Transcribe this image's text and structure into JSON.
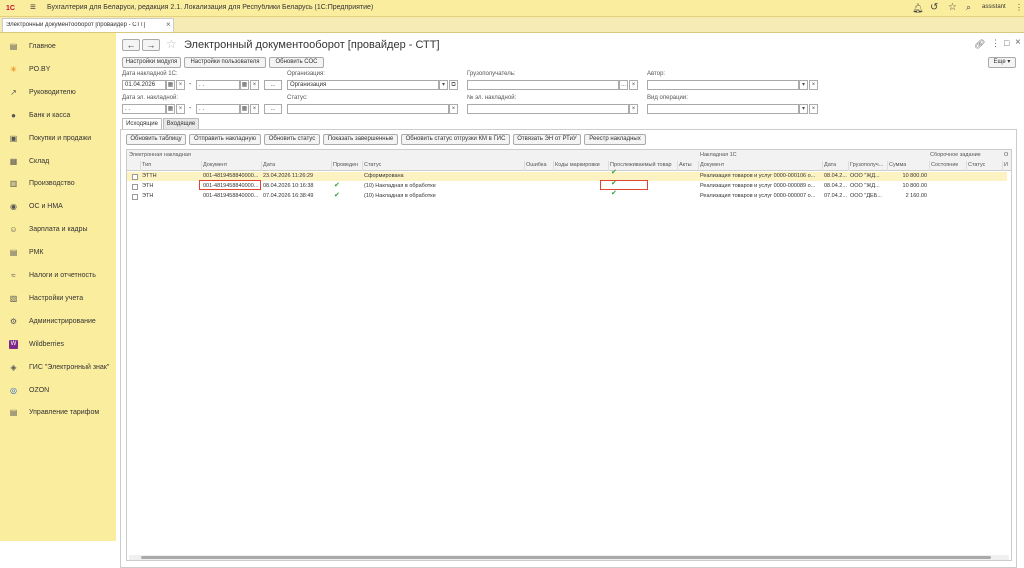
{
  "app": {
    "title": "Бухгалтерия для Беларуси, редакция 2.1. Локализация для Республики Беларусь   (1С:Предприятие)",
    "user": "assistant"
  },
  "tab": {
    "label": "Электронный документооборот [провайдер - СТТ]"
  },
  "sidebar": {
    "items": [
      {
        "label": "Главное",
        "icon": "menu-icon"
      },
      {
        "label": "PO.BY",
        "icon": "star-icon"
      },
      {
        "label": "Руководителю",
        "icon": "chart-icon"
      },
      {
        "label": "Банк и касса",
        "icon": "coin-icon"
      },
      {
        "label": "Покупки и продажи",
        "icon": "cart-icon"
      },
      {
        "label": "Склад",
        "icon": "warehouse-icon"
      },
      {
        "label": "Производство",
        "icon": "factory-icon"
      },
      {
        "label": "ОС и НМА",
        "icon": "car-icon"
      },
      {
        "label": "Зарплата и кадры",
        "icon": "people-icon"
      },
      {
        "label": "РМК",
        "icon": "register-icon"
      },
      {
        "label": "Налоги и отчетность",
        "icon": "tax-icon"
      },
      {
        "label": "Настройки учета",
        "icon": "settings-doc-icon"
      },
      {
        "label": "Администрирование",
        "icon": "gear-icon"
      },
      {
        "label": "Wildberries",
        "icon": "wildberries-icon"
      },
      {
        "label": "ГИС \"Электронный знак\"",
        "icon": "gis-icon"
      },
      {
        "label": "OZON",
        "icon": "ozon-icon"
      },
      {
        "label": "Управление тарифом",
        "icon": "tariff-icon"
      }
    ]
  },
  "page": {
    "title": "Электронный документооборот [провайдер - СТТ]",
    "more_label": "Еще"
  },
  "toolbar": {
    "module_settings": "Настройки модуля",
    "user_settings": "Настройки пользователя",
    "update_sos": "Обновить СОС"
  },
  "filters": {
    "invoice_date_1c_label": "Дата накладной 1С:",
    "invoice_date_1c_from": "01.04.2026",
    "invoice_date_1c_to": "  .  .",
    "org_label": "Организация:",
    "org_value": "Организация",
    "consignee_label": "Грузополучатель:",
    "consignee_value": "",
    "author_label": "Автор:",
    "author_value": "",
    "en_date_label": "Дата эл. накладной:",
    "en_date_from": "  .  .",
    "en_date_to": "  .  .",
    "status_label": "Статус:",
    "status_value": "",
    "en_number_label": "№ эл. накладной:",
    "en_number_value": "",
    "op_type_label": "Вид операции:",
    "op_type_value": ""
  },
  "subtabs": [
    "Исходящие",
    "Входящие"
  ],
  "actions": [
    "Обновить таблицу",
    "Отправить накладную",
    "Обновить статус",
    "Показать завершенные",
    "Обновить статус отгрузки КМ в ГИС",
    "Отвязать ЭН от РТиУ",
    "Реестр накладных"
  ],
  "table": {
    "groups": {
      "en": "Электронная накладная",
      "inv1c": "Накладная 1С",
      "assembly": "Сборочное задание",
      "last": "О"
    },
    "headers": {
      "type": "Тип",
      "doc": "Документ",
      "date": "Дата",
      "posted": "Проведен",
      "status": "Статус",
      "error": "Ошибка",
      "codes": "Коды маркировки",
      "tracked": "Прослеживаемый товар",
      "acts": "Акты",
      "doc1c": "Документ",
      "date1c": "Дата",
      "consignee": "Грузополуч...",
      "sum": "Сумма",
      "state": "Состояние",
      "astatus": "Статус",
      "last": "И"
    },
    "rows": [
      {
        "type": "ЭТТН",
        "doc": "001-4819458840000...",
        "date": "23.04.2026 11:26:29",
        "posted": false,
        "status": "Сформирована",
        "tracked": true,
        "doc1c": "Реализация товаров и услуг 0000-000106 о...",
        "date1c": "08.04.2...",
        "consignee": "ООО \"ЖД...",
        "sum": "10 800.00"
      },
      {
        "type": "ЭТН",
        "doc": "001-4819458840000...",
        "date": "08.04.2026 10:16:38",
        "posted": true,
        "status": "(10) Накладная в обработке",
        "tracked": true,
        "doc1c": "Реализация товаров и услуг 0000-000089 о...",
        "date1c": "08.04.2...",
        "consignee": "ООО \"ЖД...",
        "sum": "10 800.00"
      },
      {
        "type": "ЭТН",
        "doc": "001-4819458840000...",
        "date": "07.04.2026 16:38:49",
        "posted": true,
        "status": "(10) Накладная в обработке",
        "tracked": true,
        "doc1c": "Реализация товаров и услуг 0000-000007 о...",
        "date1c": "07.04.2...",
        "consignee": "ООО \"ДЕБ...",
        "sum": "2 160.00"
      }
    ]
  },
  "colors": {
    "titlebar": "#fbed9e",
    "accent_row": "#fdf3c2",
    "highlight": "#e0452f",
    "check": "#2e9f3a"
  }
}
